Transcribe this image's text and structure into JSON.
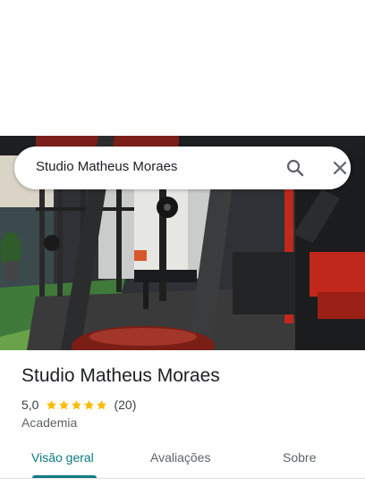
{
  "search": {
    "query": "Studio Matheus Moraes"
  },
  "icons": {
    "search": "search-icon",
    "close": "close-icon",
    "star": "star-icon"
  },
  "place": {
    "name": "Studio Matheus Moraes",
    "rating": "5,0",
    "stars": 5,
    "review_count": "(20)",
    "category": "Academia"
  },
  "tabs": [
    {
      "label": "Visão geral",
      "active": true
    },
    {
      "label": "Avaliações",
      "active": false
    },
    {
      "label": "Sobre",
      "active": false
    }
  ],
  "colors": {
    "accent": "#0b7b80",
    "star": "#fbbc04",
    "equipment_red": "#c0281c"
  }
}
